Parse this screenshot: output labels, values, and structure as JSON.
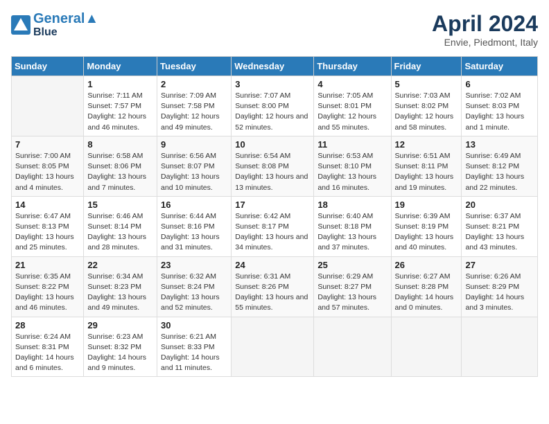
{
  "header": {
    "logo_line1": "General",
    "logo_line2": "Blue",
    "title": "April 2024",
    "subtitle": "Envie, Piedmont, Italy"
  },
  "weekdays": [
    "Sunday",
    "Monday",
    "Tuesday",
    "Wednesday",
    "Thursday",
    "Friday",
    "Saturday"
  ],
  "weeks": [
    [
      {
        "empty": true
      },
      {
        "day": "1",
        "sunrise": "7:11 AM",
        "sunset": "7:57 PM",
        "daylight": "12 hours and 46 minutes."
      },
      {
        "day": "2",
        "sunrise": "7:09 AM",
        "sunset": "7:58 PM",
        "daylight": "12 hours and 49 minutes."
      },
      {
        "day": "3",
        "sunrise": "7:07 AM",
        "sunset": "8:00 PM",
        "daylight": "12 hours and 52 minutes."
      },
      {
        "day": "4",
        "sunrise": "7:05 AM",
        "sunset": "8:01 PM",
        "daylight": "12 hours and 55 minutes."
      },
      {
        "day": "5",
        "sunrise": "7:03 AM",
        "sunset": "8:02 PM",
        "daylight": "12 hours and 58 minutes."
      },
      {
        "day": "6",
        "sunrise": "7:02 AM",
        "sunset": "8:03 PM",
        "daylight": "13 hours and 1 minute."
      }
    ],
    [
      {
        "day": "7",
        "sunrise": "7:00 AM",
        "sunset": "8:05 PM",
        "daylight": "13 hours and 4 minutes."
      },
      {
        "day": "8",
        "sunrise": "6:58 AM",
        "sunset": "8:06 PM",
        "daylight": "13 hours and 7 minutes."
      },
      {
        "day": "9",
        "sunrise": "6:56 AM",
        "sunset": "8:07 PM",
        "daylight": "13 hours and 10 minutes."
      },
      {
        "day": "10",
        "sunrise": "6:54 AM",
        "sunset": "8:08 PM",
        "daylight": "13 hours and 13 minutes."
      },
      {
        "day": "11",
        "sunrise": "6:53 AM",
        "sunset": "8:10 PM",
        "daylight": "13 hours and 16 minutes."
      },
      {
        "day": "12",
        "sunrise": "6:51 AM",
        "sunset": "8:11 PM",
        "daylight": "13 hours and 19 minutes."
      },
      {
        "day": "13",
        "sunrise": "6:49 AM",
        "sunset": "8:12 PM",
        "daylight": "13 hours and 22 minutes."
      }
    ],
    [
      {
        "day": "14",
        "sunrise": "6:47 AM",
        "sunset": "8:13 PM",
        "daylight": "13 hours and 25 minutes."
      },
      {
        "day": "15",
        "sunrise": "6:46 AM",
        "sunset": "8:14 PM",
        "daylight": "13 hours and 28 minutes."
      },
      {
        "day": "16",
        "sunrise": "6:44 AM",
        "sunset": "8:16 PM",
        "daylight": "13 hours and 31 minutes."
      },
      {
        "day": "17",
        "sunrise": "6:42 AM",
        "sunset": "8:17 PM",
        "daylight": "13 hours and 34 minutes."
      },
      {
        "day": "18",
        "sunrise": "6:40 AM",
        "sunset": "8:18 PM",
        "daylight": "13 hours and 37 minutes."
      },
      {
        "day": "19",
        "sunrise": "6:39 AM",
        "sunset": "8:19 PM",
        "daylight": "13 hours and 40 minutes."
      },
      {
        "day": "20",
        "sunrise": "6:37 AM",
        "sunset": "8:21 PM",
        "daylight": "13 hours and 43 minutes."
      }
    ],
    [
      {
        "day": "21",
        "sunrise": "6:35 AM",
        "sunset": "8:22 PM",
        "daylight": "13 hours and 46 minutes."
      },
      {
        "day": "22",
        "sunrise": "6:34 AM",
        "sunset": "8:23 PM",
        "daylight": "13 hours and 49 minutes."
      },
      {
        "day": "23",
        "sunrise": "6:32 AM",
        "sunset": "8:24 PM",
        "daylight": "13 hours and 52 minutes."
      },
      {
        "day": "24",
        "sunrise": "6:31 AM",
        "sunset": "8:26 PM",
        "daylight": "13 hours and 55 minutes."
      },
      {
        "day": "25",
        "sunrise": "6:29 AM",
        "sunset": "8:27 PM",
        "daylight": "13 hours and 57 minutes."
      },
      {
        "day": "26",
        "sunrise": "6:27 AM",
        "sunset": "8:28 PM",
        "daylight": "14 hours and 0 minutes."
      },
      {
        "day": "27",
        "sunrise": "6:26 AM",
        "sunset": "8:29 PM",
        "daylight": "14 hours and 3 minutes."
      }
    ],
    [
      {
        "day": "28",
        "sunrise": "6:24 AM",
        "sunset": "8:31 PM",
        "daylight": "14 hours and 6 minutes."
      },
      {
        "day": "29",
        "sunrise": "6:23 AM",
        "sunset": "8:32 PM",
        "daylight": "14 hours and 9 minutes."
      },
      {
        "day": "30",
        "sunrise": "6:21 AM",
        "sunset": "8:33 PM",
        "daylight": "14 hours and 11 minutes."
      },
      {
        "empty": true
      },
      {
        "empty": true
      },
      {
        "empty": true
      },
      {
        "empty": true
      }
    ]
  ],
  "labels": {
    "sunrise": "Sunrise:",
    "sunset": "Sunset:",
    "daylight": "Daylight:"
  }
}
